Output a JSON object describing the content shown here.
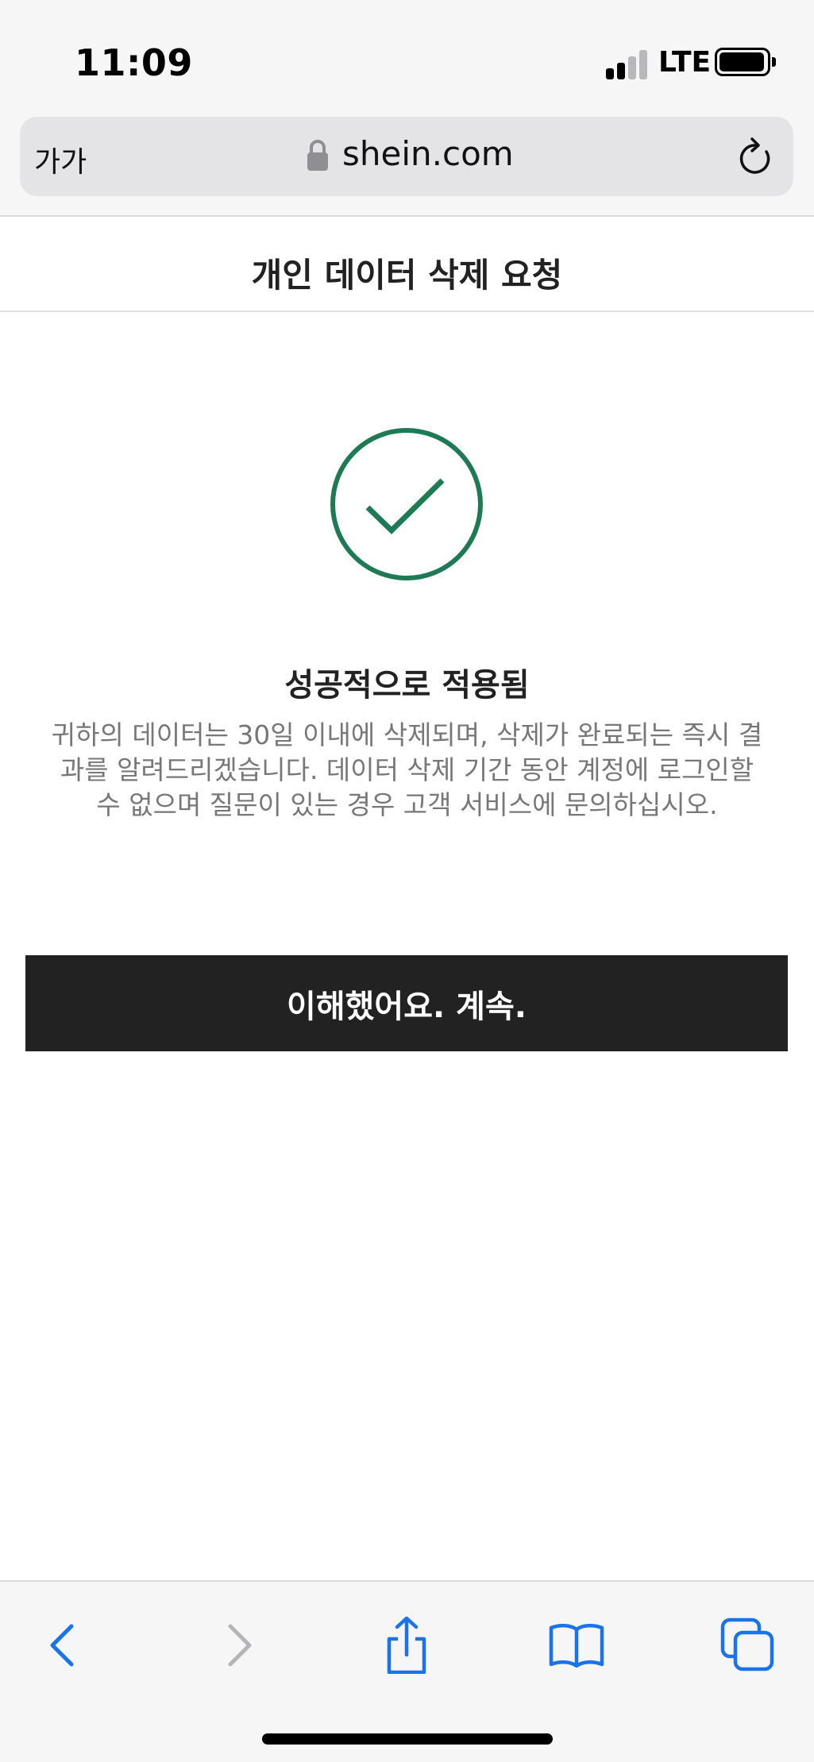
{
  "status_bar": {
    "time": "11:09",
    "network": "LTE"
  },
  "address_bar": {
    "text_size_button": "가가",
    "url": "shein.com"
  },
  "page": {
    "title": "개인 데이터 삭제 요청",
    "success_title": "성공적으로 적용됨",
    "success_description": "귀하의 데이터는 30일 이내에 삭제되며, 삭제가 완료되는 즉시 결과를 알려드리겠습니다. 데이터 삭제 기간 동안 계정에 로그인할 수 없으며 질문이 있는 경우 고객 서비스에 문의하십시오.",
    "confirm_button": "이해했어요. 계속."
  },
  "toolbar": {
    "icons": [
      "back-icon",
      "forward-icon",
      "share-icon",
      "bookmarks-icon",
      "tabs-icon"
    ]
  },
  "colors": {
    "success_green": "#1e7a55",
    "button_dark": "#222222",
    "link_blue": "#1a73e8"
  }
}
